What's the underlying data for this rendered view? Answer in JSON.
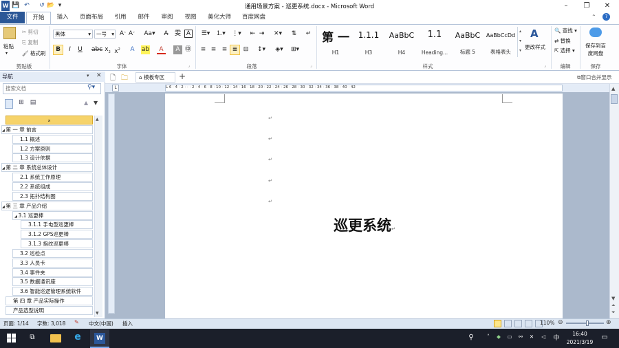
{
  "window": {
    "title": "通用场景方案 - 巡更系统.docx - Microsoft Word",
    "controls": [
      "–",
      "❐",
      "✕"
    ]
  },
  "qat": {
    "word": "W",
    "save": "💾",
    "undo": "↶",
    "redo": "↺",
    "open": "📂",
    "more": "▾"
  },
  "tabs": [
    "文件",
    "开始",
    "插入",
    "页面布局",
    "引用",
    "邮件",
    "审阅",
    "视图",
    "美化大师",
    "百度网盘"
  ],
  "ribbon": {
    "clipboard": {
      "paste": "粘贴",
      "cut": "剪切",
      "copy": "复制",
      "format_painter": "格式刷",
      "label": "剪贴板"
    },
    "font": {
      "name": "黑体",
      "size": "一号",
      "label": "字体"
    },
    "paragraph": {
      "label": "段落"
    },
    "styles": {
      "items": [
        {
          "preview": "第 一",
          "name": "H1"
        },
        {
          "preview": "1.1.1",
          "name": "H3"
        },
        {
          "preview": "AaBbC",
          "name": "H4"
        },
        {
          "preview": "1.1",
          "name": "Heading..."
        },
        {
          "preview": "AaBbC",
          "name": "标题 5"
        },
        {
          "preview": "AaBbCcDd",
          "name": "表格表头"
        }
      ],
      "change": "更改样式",
      "label": "样式"
    },
    "editing": {
      "find": "查找",
      "replace": "替换",
      "select": "选择",
      "label": "编辑"
    },
    "save": {
      "line1": "保存到百",
      "line2": "度网盘",
      "label": "保存"
    }
  },
  "nav": {
    "title": "导航",
    "search_placeholder": "搜索文档",
    "items": [
      {
        "text": "⌅",
        "level": 0
      },
      {
        "text": "第 一 章 前言",
        "level": 1
      },
      {
        "text": "1.1 概述",
        "level": 2
      },
      {
        "text": "1.2 方案原则",
        "level": 2
      },
      {
        "text": "1.3 设计依据",
        "level": 2
      },
      {
        "text": "第 二 章 系统总体设计",
        "level": 1
      },
      {
        "text": "2.1 系统工作原理",
        "level": 2
      },
      {
        "text": "2.2 系统组成",
        "level": 2
      },
      {
        "text": "2.3 拓扑结构图",
        "level": 2
      },
      {
        "text": "第 三 章 产品介绍",
        "level": 1
      },
      {
        "text": "3.1 巡更棒",
        "level": 2
      },
      {
        "text": "3.1.1 手电型巡更棒",
        "level": 3
      },
      {
        "text": "3.1.2 GPS巡更棒",
        "level": 3
      },
      {
        "text": "3.1.3 指纹巡更棒",
        "level": 3
      },
      {
        "text": "3.2 巡检点",
        "level": 2
      },
      {
        "text": "3.3 人员卡",
        "level": 2
      },
      {
        "text": "3.4 事件夹",
        "level": 2
      },
      {
        "text": "3.5 数据通讯座",
        "level": 2
      },
      {
        "text": "3.6 智能巡逻管理系统软件",
        "level": 2
      },
      {
        "text": "第 四 章 产品实际操作",
        "level": 1
      },
      {
        "text": "产品选型说明",
        "level": 1
      }
    ]
  },
  "doc_toolbar": {
    "tab": "模板专区",
    "add": "+",
    "right": "窗口合并显示"
  },
  "ruler": "L 6 · 4 · 2 · · · 2 · 4 · 6 · 8 · 10 · 12 · 14 · 16 · 18 · 20 · 22 · 24 · 26 · 28 · 30 · 32 · 34 · 36 · 38 · 40 · 42",
  "document": {
    "para_mark": "↵",
    "title": "巡更系统"
  },
  "status": {
    "page": "页面: 1/14",
    "words": "字数: 3,018",
    "lang": "中文(中国)",
    "mode": "插入",
    "zoom": "110%"
  },
  "taskbar": {
    "time": "16:40",
    "date": "2021/3/19",
    "ime": "中"
  }
}
